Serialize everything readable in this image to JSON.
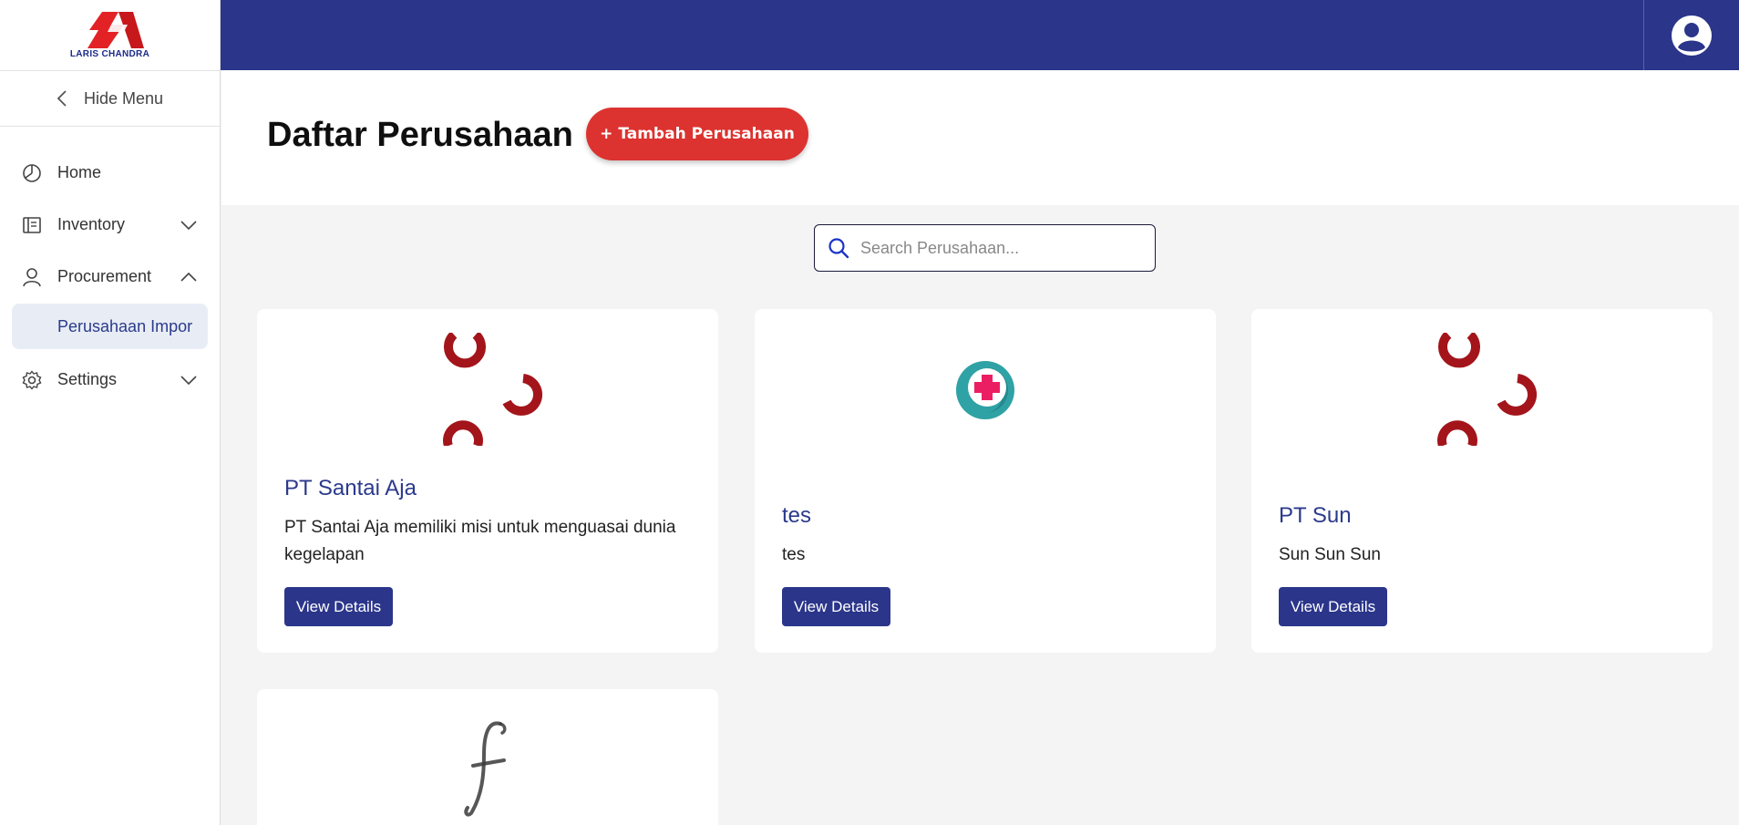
{
  "app": {
    "logo_text": "LARIS CHANDRA",
    "brand_color": "#2b358a",
    "accent_color": "#dc3330"
  },
  "sidebar": {
    "hide_menu_label": "Hide Menu",
    "items": [
      {
        "label": "Home",
        "icon": "chart-pie-icon"
      },
      {
        "label": "Inventory",
        "icon": "inventory-icon",
        "chevron": "chevron-down-icon"
      },
      {
        "label": "Procurement",
        "icon": "user-icon",
        "chevron": "chevron-up-icon"
      },
      {
        "label": "Settings",
        "icon": "gear-icon",
        "chevron": "chevron-down-icon"
      }
    ],
    "sub_item_label": "Perusahaan Impor"
  },
  "header": {
    "title": "Daftar Perusahaan",
    "add_button_label": "+ Tambah Perusahaan"
  },
  "search": {
    "placeholder": "Search Perusahaan..."
  },
  "companies": [
    {
      "name": "PT Santai Aja",
      "description": "PT Santai Aja memiliki misi untuk menguasai dunia kegelapan",
      "button_label": "View Details"
    },
    {
      "name": "tes",
      "description": "tes",
      "button_label": "View Details"
    },
    {
      "name": "PT Sun",
      "description": "Sun Sun Sun",
      "button_label": "View Details"
    }
  ]
}
